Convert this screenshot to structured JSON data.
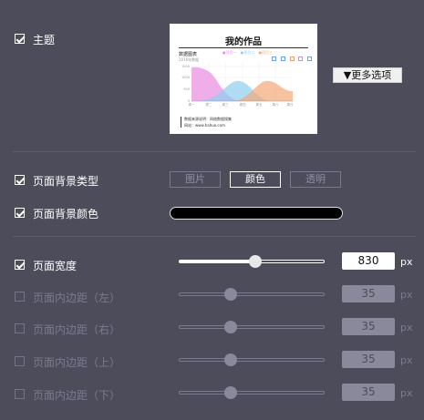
{
  "theme": {
    "label": "主题",
    "checked": true,
    "thumbnail": {
      "title": "我的作品",
      "chart_title": "数据图表",
      "chart_subtitle": "2016年数据",
      "legend": [
        "●项目一",
        "●项目二",
        "●项目三"
      ],
      "y_ticks": [
        "1500",
        "1000",
        "500",
        "0"
      ],
      "x_ticks": [
        "周一",
        "周二",
        "周三",
        "周四",
        "周五",
        "周六",
        "周日"
      ],
      "footer_line1": "数据来源说明：网络数据搜集",
      "footer_line2": "网站：www.hahuo.com"
    },
    "more_button": "▼更多选项"
  },
  "bg_type": {
    "label": "页面背景类型",
    "checked": true,
    "options": [
      "图片",
      "颜色",
      "透明"
    ],
    "selected": "颜色"
  },
  "bg_color": {
    "label": "页面背景颜色",
    "checked": true,
    "value_color": "#000000"
  },
  "page_width": {
    "label": "页面宽度",
    "checked": true,
    "value": "830",
    "unit": "px",
    "slider_fraction": 0.55
  },
  "padding": [
    {
      "label": "页面内边距（左）",
      "value": "35",
      "unit": "px",
      "checked": false,
      "slider_fraction": 0.35
    },
    {
      "label": "页面内边距（右）",
      "value": "35",
      "unit": "px",
      "checked": false,
      "slider_fraction": 0.35
    },
    {
      "label": "页面内边距（上）",
      "value": "35",
      "unit": "px",
      "checked": false,
      "slider_fraction": 0.35
    },
    {
      "label": "页面内边距（下）",
      "value": "35",
      "unit": "px",
      "checked": false,
      "slider_fraction": 0.35
    }
  ],
  "colors": {
    "background": "#4d4c5b",
    "disabled_text": "#7b7a90",
    "series": [
      "#e88be0",
      "#8ecff0",
      "#f4a878"
    ]
  }
}
